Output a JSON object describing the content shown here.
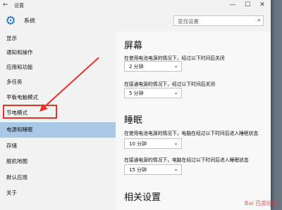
{
  "window": {
    "title": "设置",
    "back_icon": "←",
    "min_icon": "—",
    "max_icon": "☐",
    "close_icon": "✕"
  },
  "header": {
    "system_label": "系统",
    "gear_icon": "⚙",
    "search_placeholder": "查找设置",
    "search_icon": "⌕"
  },
  "sidebar": {
    "items": [
      {
        "label": "显示"
      },
      {
        "label": "通知和操作"
      },
      {
        "label": "应用和功能"
      },
      {
        "label": "多任务"
      },
      {
        "label": "平板电脑模式"
      },
      {
        "label": "节电模式"
      },
      {
        "label": "电源和睡眠"
      },
      {
        "label": "存储"
      },
      {
        "label": "脱机地图"
      },
      {
        "label": "默认应用"
      },
      {
        "label": "关于"
      }
    ],
    "selected": "电源和睡眠"
  },
  "main": {
    "screen": {
      "title": "屏幕",
      "battery_label": "在使用电池电源的情况下，经过以下时间后关闭",
      "battery_value": "2 分钟",
      "plugged_label": "在接通电源的情况下，经过以下时间后关闭",
      "plugged_value": "5 分钟"
    },
    "sleep": {
      "title": "睡眠",
      "battery_label": "在使用电池电源的情况下，电脑在经过以下时间后进入睡眠状态",
      "battery_value": "10 分钟",
      "plugged_label": "在接通电源的情况下，电脑在经过以下时间后进入睡眠状态",
      "plugged_value": "15 分钟"
    },
    "related": {
      "title": "相关设置"
    }
  },
  "chevron": "⌄",
  "watermark": "Bai 百度经验",
  "colors": {
    "selected": "#a9c8e6",
    "highlight": "#e8312a",
    "accent": "#1f6fbf"
  }
}
